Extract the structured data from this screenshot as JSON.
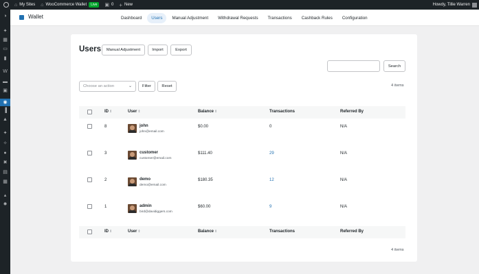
{
  "adminbar": {
    "sites_label": "My Sites",
    "site_name": "WooCommerce Wallet",
    "live_badge": "Live",
    "comments_count": "0",
    "new_label": "New",
    "greeting": "Howdy, Tillie Warren"
  },
  "sidebar": {
    "icons": [
      "palette-icon",
      "pin-icon",
      "puzzle-icon",
      "pages-icon",
      "comments-icon",
      "woo-icon",
      "products-icon",
      "media-icon",
      "wallet-icon",
      "analytics-icon",
      "megaphone-icon",
      "appearance-icon",
      "plugins-icon",
      "users-icon",
      "tools-icon",
      "settings-icon",
      "layout-icon",
      "network-icon",
      "circle-settings-icon"
    ]
  },
  "header": {
    "title": "Wallet",
    "nav": [
      "Dashboard",
      "Users",
      "Manual Adjustment",
      "Withdrawal Requests",
      "Transactions",
      "Cashback Rules",
      "Configuration"
    ],
    "active_nav": "Users"
  },
  "main": {
    "title": "Users",
    "buttons": {
      "manual_adjustment": "Manual Adjustment",
      "import": "Import",
      "export": "Export",
      "search": "Search",
      "filter": "Filter",
      "reset": "Reset"
    },
    "search_value": "",
    "bulk_placeholder": "Choose an action",
    "items_count": "4 items",
    "columns": {
      "id": "ID",
      "user": "User",
      "balance": "Balance",
      "transactions": "Transactions",
      "referred_by": "Referred By"
    },
    "rows": [
      {
        "id": "8",
        "name": "john",
        "email": "john@email.com",
        "balance": "$0.00",
        "transactions": "0",
        "referred_by": "N/A"
      },
      {
        "id": "3",
        "name": "customer",
        "email": "customer@email.com",
        "balance": "$111.40",
        "transactions": "29",
        "referred_by": "N/A"
      },
      {
        "id": "2",
        "name": "demo",
        "email": "demo@email.com",
        "balance": "$180.35",
        "transactions": "12",
        "referred_by": "N/A"
      },
      {
        "id": "1",
        "name": "admin",
        "email": "bird@davidiggers.com",
        "balance": "$60.00",
        "transactions": "9",
        "referred_by": "N/A"
      }
    ]
  },
  "colors": {
    "accent": "#2271b1",
    "adminbar_bg": "#1d2327",
    "live_green": "#00a32a"
  }
}
